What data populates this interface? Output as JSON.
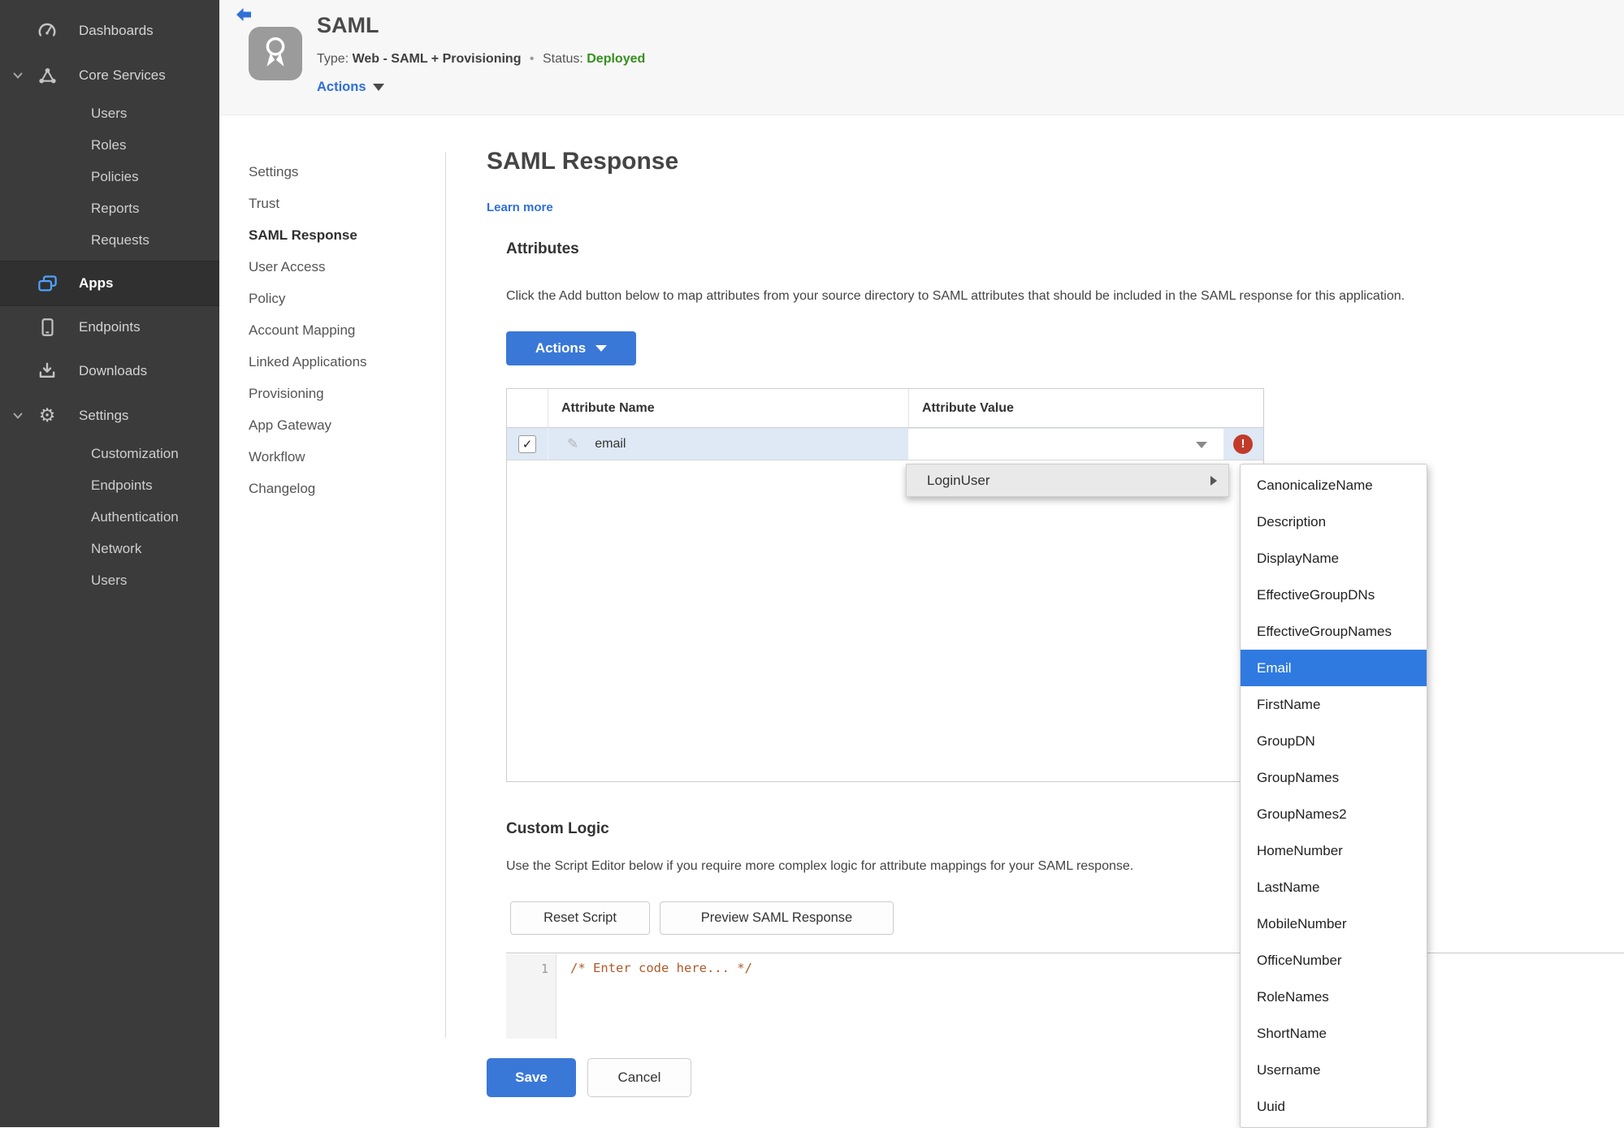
{
  "sidebar": {
    "dashboards": "Dashboards",
    "core_services": "Core Services",
    "core_children": [
      "Users",
      "Roles",
      "Policies",
      "Reports",
      "Requests"
    ],
    "apps": "Apps",
    "endpoints": "Endpoints",
    "downloads": "Downloads",
    "settings": "Settings",
    "settings_children": [
      "Customization",
      "Endpoints",
      "Authentication",
      "Network",
      "Users"
    ]
  },
  "header": {
    "title": "SAML",
    "type_label": "Type:",
    "type_value": "Web - SAML + Provisioning",
    "separator": "•",
    "status_label": "Status:",
    "status_value": "Deployed",
    "actions_label": "Actions"
  },
  "nav": {
    "items": [
      "Settings",
      "Trust",
      "SAML Response",
      "User Access",
      "Policy",
      "Account Mapping",
      "Linked Applications",
      "Provisioning",
      "App Gateway",
      "Workflow",
      "Changelog"
    ],
    "active": "SAML Response"
  },
  "main": {
    "title": "SAML Response",
    "learn_more": "Learn more",
    "attributes": {
      "heading": "Attributes",
      "description": "Click the Add button below to map attributes from your source directory to SAML attributes that should be included in the SAML response for this application.",
      "actions_button": "Actions",
      "table": {
        "columns": [
          "Attribute Name",
          "Attribute Value"
        ],
        "row": {
          "name": "email",
          "value": ""
        }
      }
    },
    "dropdown": {
      "parent": "LoginUser",
      "selected": "Email",
      "items": [
        "CanonicalizeName",
        "Description",
        "DisplayName",
        "EffectiveGroupDNs",
        "EffectiveGroupNames",
        "Email",
        "FirstName",
        "GroupDN",
        "GroupNames",
        "GroupNames2",
        "HomeNumber",
        "LastName",
        "MobileNumber",
        "OfficeNumber",
        "RoleNames",
        "ShortName",
        "Username",
        "Uuid"
      ]
    },
    "custom_logic": {
      "heading": "Custom Logic",
      "description": "Use the Script Editor below if you require more complex logic for attribute mappings for your SAML response.",
      "reset_button": "Reset Script",
      "preview_button": "Preview SAML Response",
      "editor": {
        "line_number": "1",
        "code": "/* Enter code here... */"
      }
    },
    "save_button": "Save",
    "cancel_button": "Cancel"
  },
  "icons": {
    "check": "✓",
    "pencil": "✎",
    "gear": "⚙",
    "error": "!"
  },
  "colors": {
    "accent_blue": "#3a78d7",
    "link_blue": "#2f6fd8",
    "status_green": "#368f1f",
    "error_red": "#c23b2a",
    "row_highlight": "#dee9f5",
    "menu_highlight": "#2f7ae0",
    "sidebar_bg": "#3b3b3b"
  }
}
